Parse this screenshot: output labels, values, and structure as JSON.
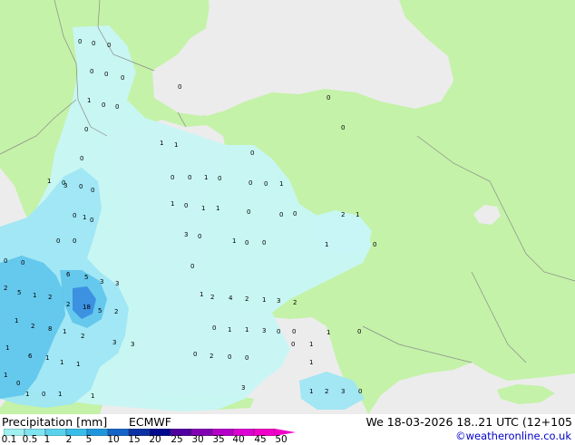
{
  "legend": {
    "title": "Precipitation [mm]",
    "model": "ECMWF",
    "validity": "We 18-03-2026 18..21 UTC (12+105",
    "credit": "©weatheronline.co.uk",
    "scale_labels": [
      "0.1",
      "0.5",
      "1",
      "2",
      "5",
      "10",
      "15",
      "20",
      "25",
      "30",
      "35",
      "40",
      "45",
      "50"
    ],
    "scale_colors": [
      "#a0f0f0",
      "#80e4f0",
      "#5ad2ee",
      "#38bce8",
      "#1e96dc",
      "#1464c8",
      "#0a32a6",
      "#000a8c",
      "#5000a0",
      "#8200b4",
      "#b400c8",
      "#dc00d2",
      "#f000c8"
    ]
  },
  "map": {
    "land_color": "#c4f2a8",
    "sea_color": "#ececec",
    "light_precip_color": "#c8f6f6",
    "moderate_precip_color": "#9fe6f4",
    "heavy_precip_color": "#62c6ec",
    "intense_precip_color": "#3a8ee0",
    "value_labels": [
      {
        "t": "0"
      },
      {
        "t": "0"
      },
      {
        "t": "0"
      },
      {
        "t": "0"
      },
      {
        "t": "0"
      },
      {
        "t": "0"
      },
      {
        "t": "0"
      },
      {
        "t": "1"
      },
      {
        "t": "0"
      },
      {
        "t": "0"
      },
      {
        "t": "0"
      },
      {
        "t": "1"
      },
      {
        "t": "1"
      },
      {
        "t": "0"
      },
      {
        "t": "0"
      },
      {
        "t": "0"
      },
      {
        "t": "1"
      },
      {
        "t": "3"
      },
      {
        "t": "0"
      },
      {
        "t": "0"
      },
      {
        "t": "0"
      },
      {
        "t": "0"
      },
      {
        "t": "1"
      },
      {
        "t": "0"
      },
      {
        "t": "0"
      },
      {
        "t": "0"
      },
      {
        "t": "1"
      },
      {
        "t": "1"
      },
      {
        "t": "0"
      },
      {
        "t": "1"
      },
      {
        "t": "1"
      },
      {
        "t": "0"
      },
      {
        "t": "0"
      },
      {
        "t": "0"
      },
      {
        "t": "2"
      },
      {
        "t": "1"
      },
      {
        "t": "0"
      },
      {
        "t": "1"
      },
      {
        "t": "0"
      },
      {
        "t": "0"
      },
      {
        "t": "0"
      },
      {
        "t": "0"
      },
      {
        "t": "0"
      },
      {
        "t": "3"
      },
      {
        "t": "0"
      },
      {
        "t": "1"
      },
      {
        "t": "6"
      },
      {
        "t": "5"
      },
      {
        "t": "3"
      },
      {
        "t": "3"
      },
      {
        "t": "2"
      },
      {
        "t": "1"
      },
      {
        "t": "5"
      },
      {
        "t": "2"
      },
      {
        "t": "18"
      },
      {
        "t": "2"
      },
      {
        "t": "5"
      },
      {
        "t": "2"
      },
      {
        "t": "0"
      },
      {
        "t": "1"
      },
      {
        "t": "2"
      },
      {
        "t": "4"
      },
      {
        "t": "2"
      },
      {
        "t": "1"
      },
      {
        "t": "3"
      },
      {
        "t": "2"
      },
      {
        "t": "1"
      },
      {
        "t": "2"
      },
      {
        "t": "8"
      },
      {
        "t": "1"
      },
      {
        "t": "2"
      },
      {
        "t": "3"
      },
      {
        "t": "3"
      },
      {
        "t": "6"
      },
      {
        "t": "1"
      },
      {
        "t": "1"
      },
      {
        "t": "1"
      },
      {
        "t": "1"
      },
      {
        "t": "1"
      },
      {
        "t": "0"
      },
      {
        "t": "1"
      },
      {
        "t": "0"
      },
      {
        "t": "1"
      },
      {
        "t": "1"
      },
      {
        "t": "0"
      },
      {
        "t": "1"
      },
      {
        "t": "1"
      },
      {
        "t": "3"
      },
      {
        "t": "0"
      },
      {
        "t": "0"
      },
      {
        "t": "1"
      },
      {
        "t": "0"
      },
      {
        "t": "0"
      },
      {
        "t": "2"
      },
      {
        "t": "0"
      },
      {
        "t": "0"
      },
      {
        "t": "1"
      },
      {
        "t": "0"
      },
      {
        "t": "3"
      },
      {
        "t": "1"
      },
      {
        "t": "2"
      },
      {
        "t": "3"
      },
      {
        "t": "0"
      },
      {
        "t": "1"
      },
      {
        "t": "0"
      },
      {
        "t": "1"
      },
      {
        "t": "0"
      },
      {
        "t": "0"
      },
      {
        "t": "0"
      },
      {
        "t": "0"
      }
    ]
  }
}
